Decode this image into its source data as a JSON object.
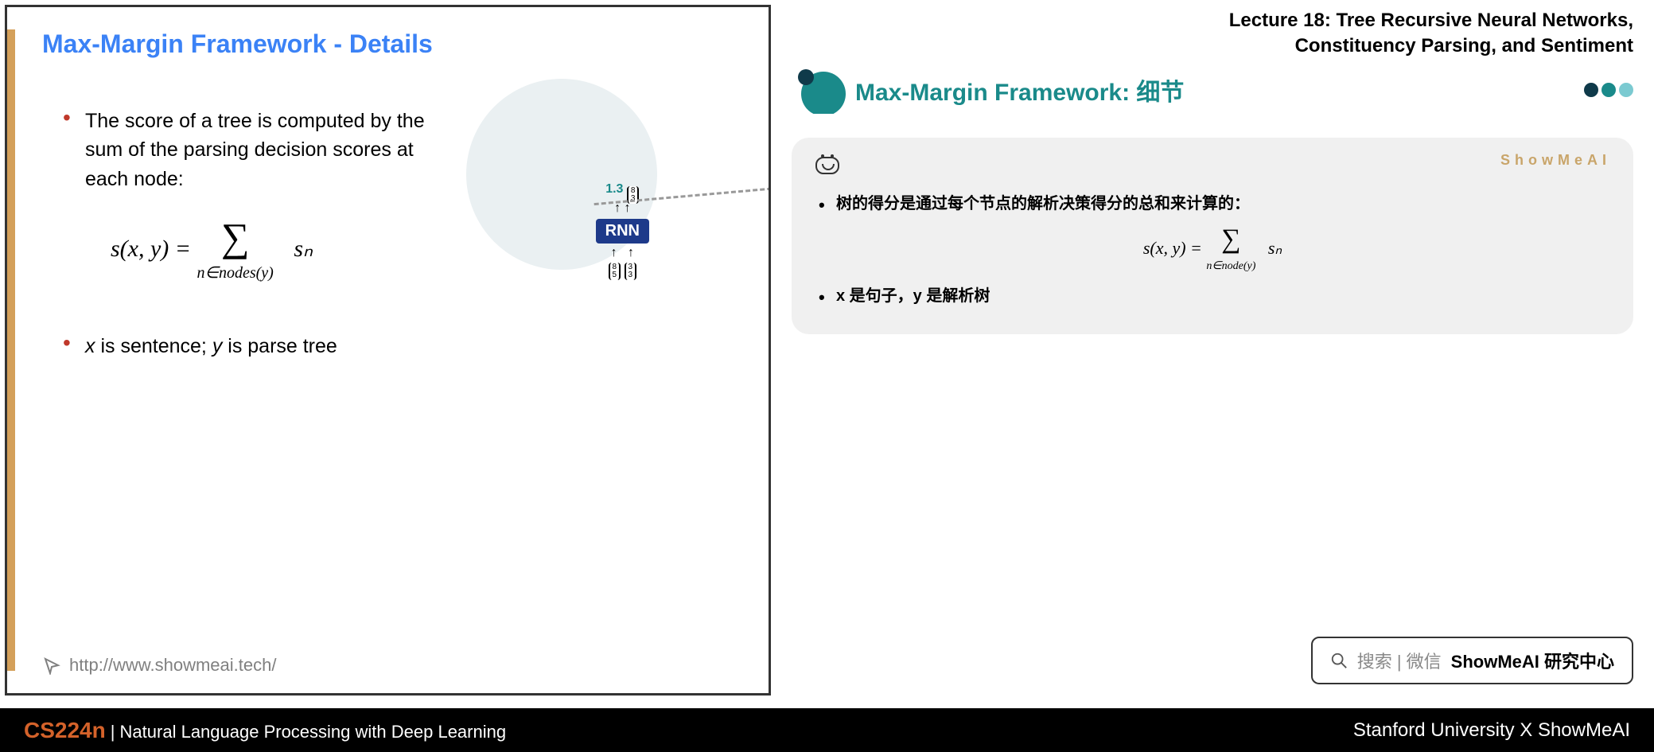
{
  "slide": {
    "title": "Max-Margin Framework - Details",
    "bullet1": "The score of a tree is computed by the sum of the parsing decision scores at each node:",
    "bullet2_html": "x is sentence; y is parse tree",
    "formula_lhs": "s(x, y) = ",
    "formula_rhs": "sₙ",
    "formula_sub": "n∈nodes(y)",
    "rnn_score": "1.3",
    "rnn_label": "RNN",
    "url": "http://www.showmeai.tech/"
  },
  "right": {
    "lecture_line1": "Lecture 18: Tree Recursive Neural Networks,",
    "lecture_line2": "Constituency Parsing, and Sentiment",
    "subtitle": "Max-Margin Framework: 细节",
    "brand": "ShowMeAI",
    "note_bullet1": "树的得分是通过每个节点的解析决策得分的总和来计算的：",
    "note_formula_lhs": "s(x, y) = ",
    "note_formula_rhs": "sₙ",
    "note_formula_sub": "n∈node(y)",
    "note_bullet2": "x 是句子，y 是解析树",
    "search_hint": "搜索 | 微信",
    "search_bold": "ShowMeAI 研究中心"
  },
  "footer": {
    "course": "CS224n",
    "sep": " | ",
    "desc": "Natural Language Processing with Deep Learning",
    "right": "Stanford University X ShowMeAI"
  }
}
